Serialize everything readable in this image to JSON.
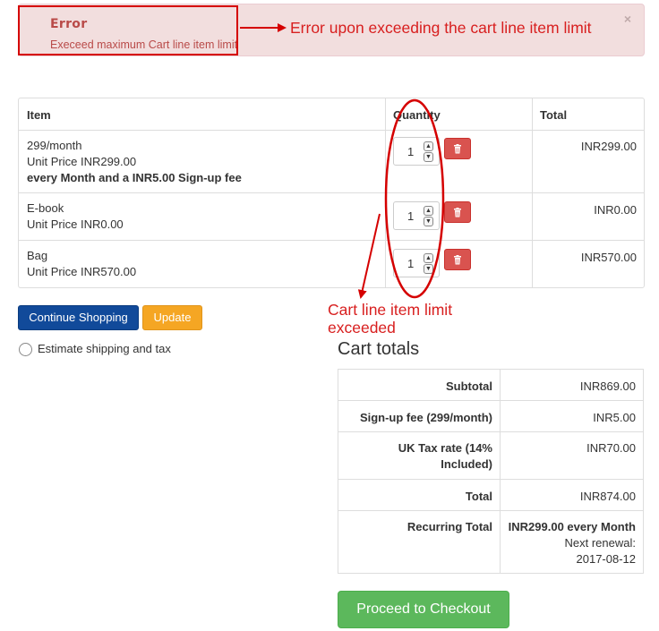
{
  "alert": {
    "title": "Error",
    "message": "Execeed maximum Cart line item limit",
    "close": "×"
  },
  "annotations": {
    "error_note": "Error upon exceeding the cart line item limit",
    "limit_note_line1": "Cart line item limit",
    "limit_note_line2": "exceeded"
  },
  "cart": {
    "headers": {
      "item": "Item",
      "quantity": "Quantity",
      "total": "Total"
    },
    "rows": [
      {
        "line1": "299/month",
        "line2": "Unit Price INR299.00",
        "line3": "every Month and a INR5.00 Sign-up fee",
        "qty": "1",
        "total": "INR299.00"
      },
      {
        "line1": "E-book",
        "line2": "Unit Price INR0.00",
        "qty": "1",
        "total": "INR0.00"
      },
      {
        "line1": "Bag",
        "line2": "Unit Price INR570.00",
        "qty": "1",
        "total": "INR570.00"
      }
    ]
  },
  "buttons": {
    "continue": "Continue Shopping",
    "update": "Update",
    "checkout": "Proceed to Checkout"
  },
  "estimate_label": "Estimate shipping and tax",
  "totals": {
    "title": "Cart totals",
    "rows": [
      {
        "label": "Subtotal",
        "value": "INR869.00"
      },
      {
        "label": "Sign-up fee (299/month)",
        "value": "INR5.00"
      },
      {
        "label1": "UK Tax rate (14%",
        "label2": "Included)",
        "value": "INR70.00"
      },
      {
        "label": "Total",
        "value": "INR874.00"
      },
      {
        "label": "Recurring Total",
        "value_bold": "INR299.00 every Month",
        "value2": "Next renewal:",
        "value3": "2017-08-12"
      }
    ]
  },
  "colors": {
    "annotation_red": "#d50000",
    "alert_bg": "#f2dede",
    "alert_text": "#b94a48",
    "continue_blue": "#114a9a",
    "update_orange": "#f5a623",
    "delete_red": "#d9534f",
    "checkout_green": "#5cb85c"
  },
  "icons": {
    "delete": "trash-icon",
    "spin_up": "chevron-up-icon",
    "spin_down": "chevron-down-icon"
  }
}
